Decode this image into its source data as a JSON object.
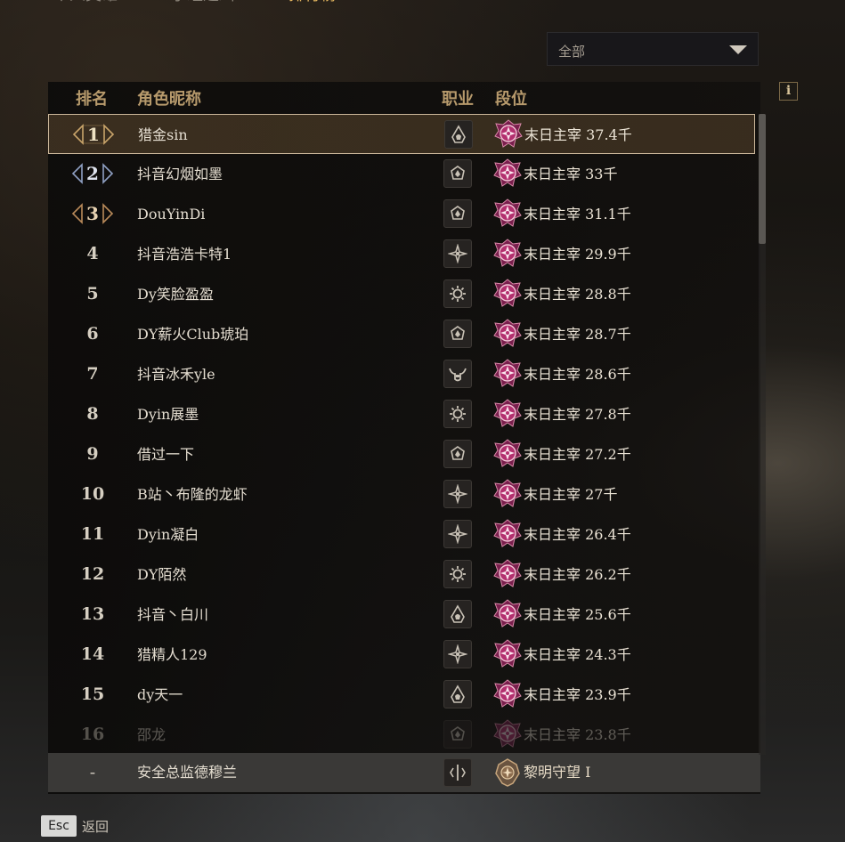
{
  "top_tabs": [
    {
      "label": "个人英雄"
    },
    {
      "label": "小组通缉"
    },
    {
      "label": "排行榜",
      "active": true
    }
  ],
  "filter": {
    "selected": "全部",
    "icon": "chevron-down-icon"
  },
  "info_button": {
    "label": "i"
  },
  "table": {
    "headers": {
      "rank": "排名",
      "name": "角色昵称",
      "class": "职业",
      "tier": "段位"
    },
    "rows": [
      {
        "rank": "1",
        "name": "猎金sin",
        "class_icon": "hooded-icon",
        "tier": "末日主宰 37.4千"
      },
      {
        "rank": "2",
        "name": "抖音幻烟如墨",
        "class_icon": "tri-blade-icon",
        "tier": "末日主宰 33千"
      },
      {
        "rank": "3",
        "name": "DouYinDi",
        "class_icon": "tri-blade-icon",
        "tier": "末日主宰 31.1千"
      },
      {
        "rank": "4",
        "name": "抖音浩浩卡特1",
        "class_icon": "star-burst-icon",
        "tier": "末日主宰 29.9千"
      },
      {
        "rank": "5",
        "name": "Dy笑脸盈盈",
        "class_icon": "sun-gear-icon",
        "tier": "末日主宰 28.8千"
      },
      {
        "rank": "6",
        "name": "DY薪火Club琥珀",
        "class_icon": "tri-blade-icon",
        "tier": "末日主宰 28.7千"
      },
      {
        "rank": "7",
        "name": "抖音冰禾yle",
        "class_icon": "horned-helm-icon",
        "tier": "末日主宰 28.6千"
      },
      {
        "rank": "8",
        "name": "Dyin展墨",
        "class_icon": "sun-gear-icon",
        "tier": "末日主宰 27.8千"
      },
      {
        "rank": "9",
        "name": "借过一下",
        "class_icon": "tri-blade-icon",
        "tier": "末日主宰 27.2千"
      },
      {
        "rank": "10",
        "name": "B站丶布隆的龙虾",
        "class_icon": "star-burst-icon",
        "tier": "末日主宰 27千"
      },
      {
        "rank": "11",
        "name": "Dyin凝白",
        "class_icon": "star-burst-icon",
        "tier": "末日主宰 26.4千"
      },
      {
        "rank": "12",
        "name": "DY陌然",
        "class_icon": "sun-gear-icon",
        "tier": "末日主宰 26.2千"
      },
      {
        "rank": "13",
        "name": "抖音丶白川",
        "class_icon": "hooded-icon",
        "tier": "末日主宰 25.6千"
      },
      {
        "rank": "14",
        "name": "猎精人129",
        "class_icon": "star-burst-icon",
        "tier": "末日主宰 24.3千"
      },
      {
        "rank": "15",
        "name": "dy天一",
        "class_icon": "hooded-icon",
        "tier": "末日主宰 23.9千"
      },
      {
        "rank": "16",
        "name": "邵龙",
        "class_icon": "tri-blade-icon",
        "tier": "末日主宰 23.8千"
      }
    ],
    "self": {
      "rank": "-",
      "name": "安全总监德穆兰",
      "class_icon": "rune-icon",
      "tier": "黎明守望 I"
    }
  },
  "footer": {
    "key": "Esc",
    "label": "返回"
  },
  "colors": {
    "accent_gold": "#b79a6c",
    "highlight_border": "#cbb79a",
    "tier_magenta": "#c8357f"
  }
}
